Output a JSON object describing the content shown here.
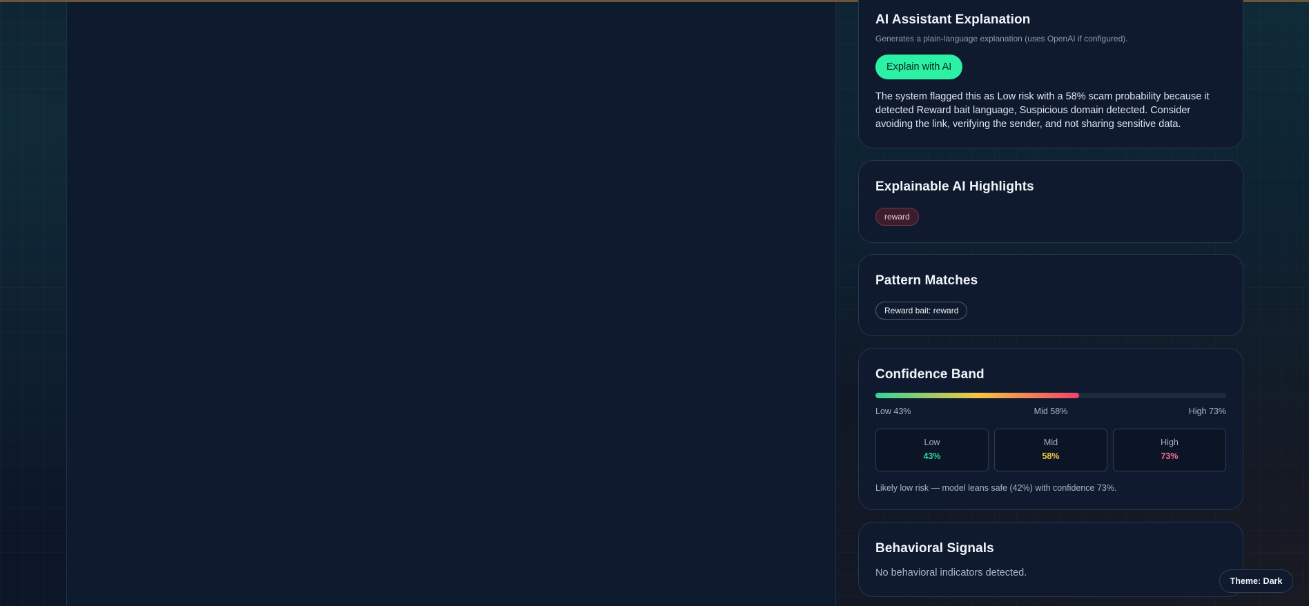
{
  "ai_explanation": {
    "title": "AI Assistant Explanation",
    "subtitle": "Generates a plain-language explanation (uses OpenAI if configured).",
    "button_label": "Explain with AI",
    "text": "The system flagged this as Low risk with a 58% scam probability because it detected Reward bait language, Suspicious domain detected. Consider avoiding the link, verifying the sender, and not sharing sensitive data."
  },
  "highlights": {
    "title": "Explainable AI Highlights",
    "chips": [
      "reward"
    ]
  },
  "patterns": {
    "title": "Pattern Matches",
    "chips": [
      "Reward bait: reward"
    ]
  },
  "confidence": {
    "title": "Confidence Band",
    "fill_percent": 58,
    "scale_labels": {
      "low": "Low 43%",
      "mid": "Mid 58%",
      "high": "High 73%"
    },
    "boxes": [
      {
        "label": "Low",
        "value": "43%",
        "color": "#34d399"
      },
      {
        "label": "Mid",
        "value": "58%",
        "color": "#f4c542"
      },
      {
        "label": "High",
        "value": "73%",
        "color": "#f87196"
      }
    ],
    "note": "Likely low risk — model leans safe (42%) with confidence 73%."
  },
  "behavioral": {
    "title": "Behavioral Signals",
    "text": "No behavioral indicators detected."
  },
  "theme_toggle": {
    "label": "Theme: Dark"
  },
  "colors": {
    "accent": "#2cf0a4",
    "background": "#0c1628"
  }
}
